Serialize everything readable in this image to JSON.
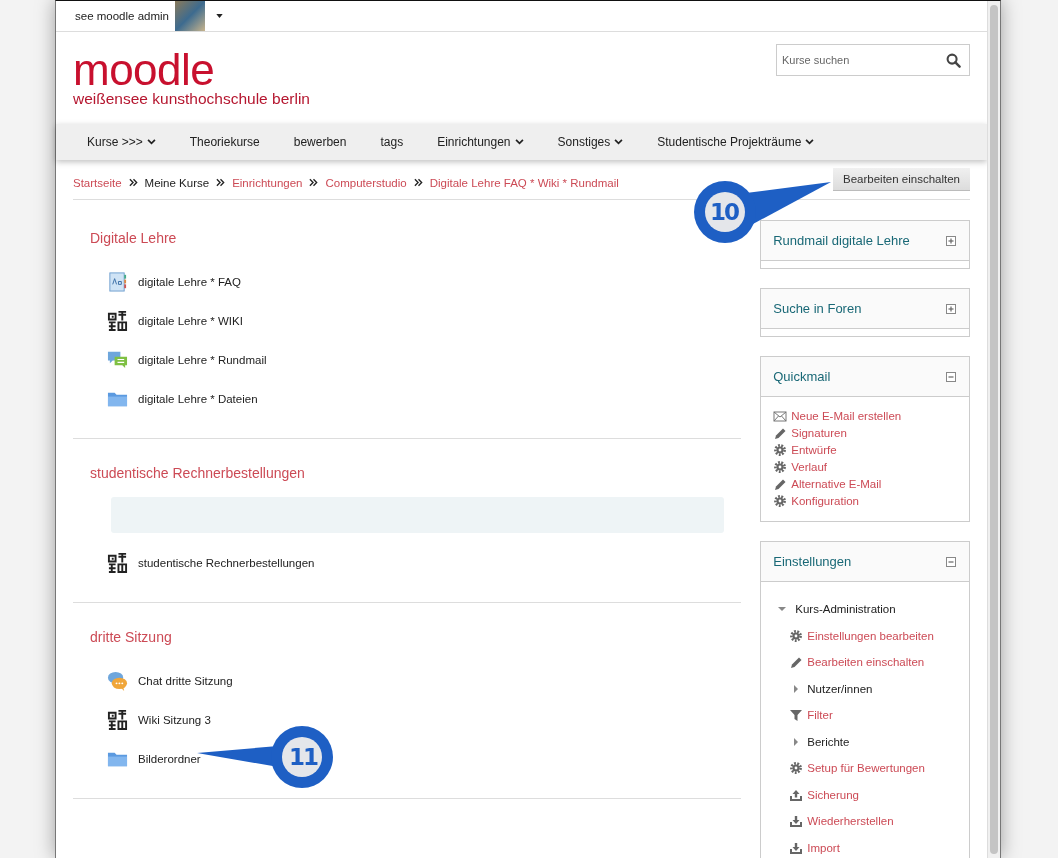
{
  "user_menu": {
    "name": "see moodle admin"
  },
  "logo": {
    "title": "moodle",
    "subtitle": "weißensee kunsthochschule berlin"
  },
  "search": {
    "placeholder": "Kurse suchen"
  },
  "nav": [
    {
      "label": "Kurse >>>",
      "dropdown": true
    },
    {
      "label": "Theoriekurse",
      "dropdown": false
    },
    {
      "label": "bewerben",
      "dropdown": false
    },
    {
      "label": "tags",
      "dropdown": false
    },
    {
      "label": "Einrichtungen",
      "dropdown": true
    },
    {
      "label": "Sonstiges",
      "dropdown": true
    },
    {
      "label": "Studentische Projekträume",
      "dropdown": true
    }
  ],
  "breadcrumb": [
    {
      "label": "Startseite",
      "link": true
    },
    {
      "label": "Meine Kurse",
      "link": false
    },
    {
      "label": "Einrichtungen",
      "link": true
    },
    {
      "label": "Computerstudio",
      "link": true
    },
    {
      "label": "Digitale Lehre FAQ * Wiki * Rundmail",
      "link": true
    }
  ],
  "edit_button": {
    "label": "Bearbeiten einschalten",
    "callout": "10"
  },
  "sections": [
    {
      "title": "Digitale Lehre",
      "activities": [
        {
          "kind": "glossary",
          "label": "digitale Lehre * FAQ"
        },
        {
          "kind": "wiki",
          "label": "digitale Lehre * WIKI"
        },
        {
          "kind": "forum",
          "label": "digitale Lehre * Rundmail"
        },
        {
          "kind": "folder",
          "label": "digitale Lehre * Dateien"
        }
      ]
    },
    {
      "title": "studentische Rechnerbestellungen",
      "activities": [
        {
          "kind": "empty-label"
        },
        {
          "kind": "wiki",
          "label": "studentische Rechnerbestellungen"
        }
      ]
    },
    {
      "title": "dritte Sitzung",
      "activities": [
        {
          "kind": "chat",
          "label": "Chat dritte Sitzung"
        },
        {
          "kind": "wiki",
          "label": "Wiki Sitzung 3"
        },
        {
          "kind": "folder",
          "label": "Bilderordner",
          "callout": "11"
        }
      ]
    }
  ],
  "blocks": [
    {
      "title": "Rundmail digitale Lehre",
      "collapsed": true
    },
    {
      "title": "Suche in Foren",
      "collapsed": true
    },
    {
      "title": "Quickmail",
      "collapsed": false,
      "links": [
        {
          "kind": "envelope",
          "label": "Neue E-Mail erstellen"
        },
        {
          "kind": "pencil",
          "label": "Signaturen"
        },
        {
          "kind": "gear",
          "label": "Entwürfe"
        },
        {
          "kind": "gear",
          "label": "Verlauf"
        },
        {
          "kind": "pencil",
          "label": "Alternative E-Mail"
        },
        {
          "kind": "gear",
          "label": "Konfiguration"
        }
      ]
    },
    {
      "title": "Einstellungen",
      "collapsed": false,
      "tree": [
        {
          "kind": "node",
          "label": "Kurs-Administration",
          "expanded": true,
          "children": [
            {
              "kind": "gear",
              "label": "Einstellungen bearbeiten"
            },
            {
              "kind": "pencil",
              "label": "Bearbeiten einschalten"
            },
            {
              "kind": "node",
              "label": "Nutzer/innen",
              "expanded": false
            },
            {
              "kind": "filter",
              "label": "Filter"
            },
            {
              "kind": "node",
              "label": "Berichte",
              "expanded": false
            },
            {
              "kind": "gear",
              "label": "Setup für Bewertungen"
            },
            {
              "kind": "upload",
              "label": "Sicherung"
            },
            {
              "kind": "download",
              "label": "Wiederherstellen"
            },
            {
              "kind": "download",
              "label": "Import"
            }
          ]
        }
      ]
    }
  ]
}
